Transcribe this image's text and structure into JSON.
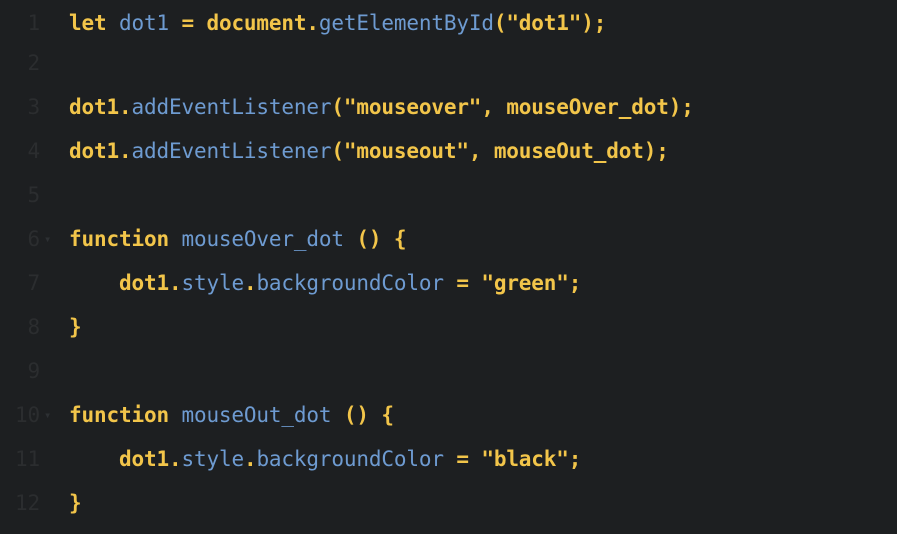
{
  "editor": {
    "lines": [
      {
        "num": "1",
        "fold": "",
        "tokens": [
          [
            "k",
            "let "
          ],
          [
            "m",
            "dot1"
          ],
          [
            "p",
            " = "
          ],
          [
            "k",
            "document"
          ],
          [
            "p",
            "."
          ],
          [
            "m",
            "getElementById"
          ],
          [
            "p",
            "("
          ],
          [
            "s",
            "\"dot1\""
          ],
          [
            "p",
            ");"
          ]
        ]
      },
      {
        "num": "2",
        "fold": "",
        "tokens": []
      },
      {
        "num": "3",
        "fold": "",
        "tokens": [
          [
            "k",
            "dot1"
          ],
          [
            "p",
            "."
          ],
          [
            "m",
            "addEventListener"
          ],
          [
            "p",
            "("
          ],
          [
            "s",
            "\"mouseover\""
          ],
          [
            "p",
            ", "
          ],
          [
            "k",
            "mouseOver_dot"
          ],
          [
            "p",
            ");"
          ]
        ]
      },
      {
        "num": "4",
        "fold": "",
        "tokens": [
          [
            "k",
            "dot1"
          ],
          [
            "p",
            "."
          ],
          [
            "m",
            "addEventListener"
          ],
          [
            "p",
            "("
          ],
          [
            "s",
            "\"mouseout\""
          ],
          [
            "p",
            ", "
          ],
          [
            "k",
            "mouseOut_dot"
          ],
          [
            "p",
            ");"
          ]
        ]
      },
      {
        "num": "5",
        "fold": "",
        "tokens": []
      },
      {
        "num": "6",
        "fold": "▾",
        "tokens": [
          [
            "k",
            "function "
          ],
          [
            "m",
            "mouseOver_dot"
          ],
          [
            "p",
            " () {"
          ]
        ]
      },
      {
        "num": "7",
        "fold": "",
        "tokens": [
          [
            "p",
            "    "
          ],
          [
            "k",
            "dot1"
          ],
          [
            "p",
            "."
          ],
          [
            "m",
            "style"
          ],
          [
            "p",
            "."
          ],
          [
            "m",
            "backgroundColor"
          ],
          [
            "p",
            " = "
          ],
          [
            "s",
            "\"green\""
          ],
          [
            "p",
            ";"
          ]
        ]
      },
      {
        "num": "8",
        "fold": "",
        "tokens": [
          [
            "p",
            "}"
          ]
        ]
      },
      {
        "num": "9",
        "fold": "",
        "tokens": []
      },
      {
        "num": "10",
        "fold": "▾",
        "tokens": [
          [
            "k",
            "function "
          ],
          [
            "m",
            "mouseOut_dot"
          ],
          [
            "p",
            " () {"
          ]
        ]
      },
      {
        "num": "11",
        "fold": "",
        "tokens": [
          [
            "p",
            "    "
          ],
          [
            "k",
            "dot1"
          ],
          [
            "p",
            "."
          ],
          [
            "m",
            "style"
          ],
          [
            "p",
            "."
          ],
          [
            "m",
            "backgroundColor"
          ],
          [
            "p",
            " = "
          ],
          [
            "s",
            "\"black\""
          ],
          [
            "p",
            ";"
          ]
        ]
      },
      {
        "num": "12",
        "fold": "",
        "tokens": [
          [
            "p",
            "}"
          ]
        ]
      }
    ]
  },
  "colors": {
    "background": "#1d1f21",
    "keyword": "#f2c54a",
    "method": "#6e9bd1",
    "gutter": "#2b2d2f"
  }
}
